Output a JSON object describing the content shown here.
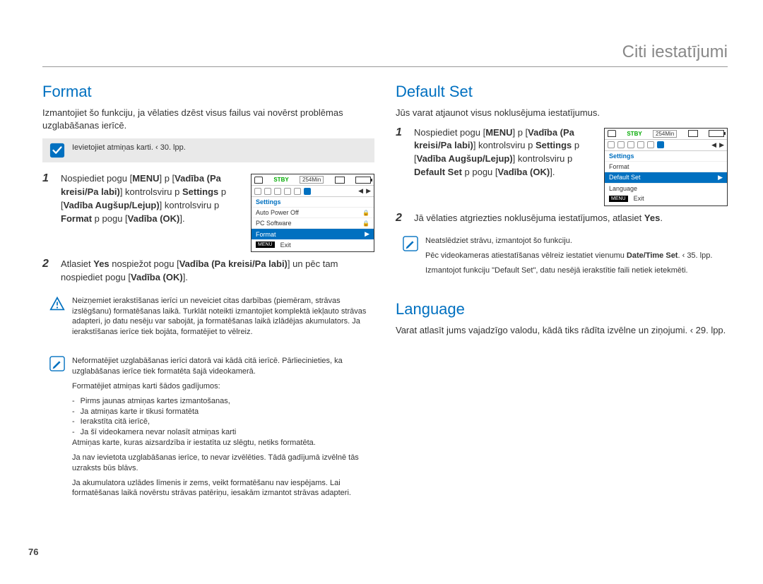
{
  "header": {
    "title": "Citi iestatījumi"
  },
  "page_number": "76",
  "left": {
    "title": "Format",
    "intro": "Izmantojiet šo funkciju, ja vēlaties dzēst visus failus vai novērst problēmas uzglabāšanas ierīcē.",
    "pre_note": "Ievietojiet atmiņas karti.  ‹ 30. lpp.",
    "step1_a": "Nospiediet pogu [",
    "step1_menu": "MENU",
    "step1_b": "]  p [",
    "step1_ctrl": "Vadība (Pa kreisi/Pa labi)",
    "step1_c": "] kontrolsviru  p ",
    "step1_settings": "Settings",
    "step1_d": "  p [",
    "step1_updown": "Vadība Augšup/Lejup)",
    "step1_e": "] kontrolsviru  p ",
    "step1_format": "Format",
    "step1_f": "  p pogu [",
    "step1_ok": "Vadība (OK)",
    "step1_g": "].",
    "step2_a": "Atlasiet ",
    "step2_yes": "Yes",
    "step2_b": " nospiežot pogu [",
    "step2_ctrl": "Vadība (Pa kreisi/Pa labi)",
    "step2_c": "] un pēc tam nospiediet pogu [",
    "step2_ok": "Vadība (OK)",
    "step2_d": "].",
    "warn_note": "Neizņemiet ierakstīšanas ierīci un neveiciet citas darbības (piemēram, strāvas izslēgšanu) formatēšanas laikā. Turklāt noteikti izmantojiet komplektā iekļauto strāvas adapteri, jo datu nesēju var sabojāt, ja formatēšanas laikā izlādējas akumulators. Ja ierakstīšanas ierīce tiek bojāta, formatējiet to vēlreiz.",
    "pencil_block": {
      "p1": "Neformatējiet uzglabāšanas ierīci datorā vai kādā citā ierīcē. Pārliecinieties, ka uzglabāšanas ierīce tiek formatēta šajā videokamerā.",
      "p2": "Formatējiet atmiņas karti šādos gadījumos:",
      "li1": "Pirms jaunas atmiņas kartes izmantošanas,",
      "li2": "Ja atmiņas karte ir tikusi formatēta",
      "li3": "Ierakstīta citā ierīcē,",
      "li4": "Ja šī videokamera nevar nolasīt atmiņas karti",
      "p3": "Atmiņas karte, kuras aizsardzība ir iestatīta uz slēgtu, netiks formatēta.",
      "p4": "Ja nav ievietota uzglabāšanas ierīce, to nevar izvēlēties. Tādā gadījumā izvēlnē tās uzraksts būs blāvs.",
      "p5": "Ja akumulatora uzlādes līmenis ir zems, veikt formatēšanu nav iespējams. Lai formatēšanas laikā novērstu strāvas patēriņu, iesakām izmantot strāvas adapteri."
    },
    "screen": {
      "stby": "STBY",
      "time": "254Min",
      "section": "Settings",
      "items": [
        "Auto Power Off",
        "PC Software",
        "Format"
      ],
      "selected_index": 2,
      "exit_menu": "MENU",
      "exit": "Exit"
    }
  },
  "right": {
    "title_default": "Default Set",
    "intro_default": "Jūs varat atjaunot visus noklusējuma iestatījumus.",
    "step1_a": "Nospiediet pogu [",
    "step1_menu": "MENU",
    "step1_b": "]  p [",
    "step1_ctrl": "Vadība (Pa kreisi/Pa labi)",
    "step1_c": "] kontrolsviru  p ",
    "step1_settings": "Settings",
    "step1_d": "  p [",
    "step1_updown": "Vadība Augšup/Lejup)",
    "step1_e": "] kontrolsviru  p ",
    "step1_default": "Default Set",
    "step1_f": "  p pogu [",
    "step1_ok": "Vadība (OK)",
    "step1_g": "].",
    "step2_a": "Jā vēlaties atgriezties noklusējuma iestatījumos, atlasiet ",
    "step2_yes": "Yes",
    "step2_b": ".",
    "pencil_block": {
      "p1": "Neatslēdziet strāvu, izmantojot šo funkciju.",
      "p2a": "Pēc videokameras atiestatīšanas vēlreiz iestatiet vienumu ",
      "p2bold": "Date/Time Set",
      "p2b": ".  ‹ 35. lpp.",
      "p3": "Izmantojot funkciju \"Default Set\", datu nesējā ierakstītie faili netiek ietekmēti."
    },
    "screen": {
      "stby": "STBY",
      "time": "254Min",
      "section": "Settings",
      "items": [
        "Format",
        "Default Set",
        "Language"
      ],
      "selected_index": 1,
      "exit_menu": "MENU",
      "exit": "Exit"
    },
    "title_language": "Language",
    "intro_language": "Varat atlasīt jums vajadzīgo valodu, kādā tiks rādīta izvēlne un ziņojumi.  ‹ 29. lpp."
  }
}
